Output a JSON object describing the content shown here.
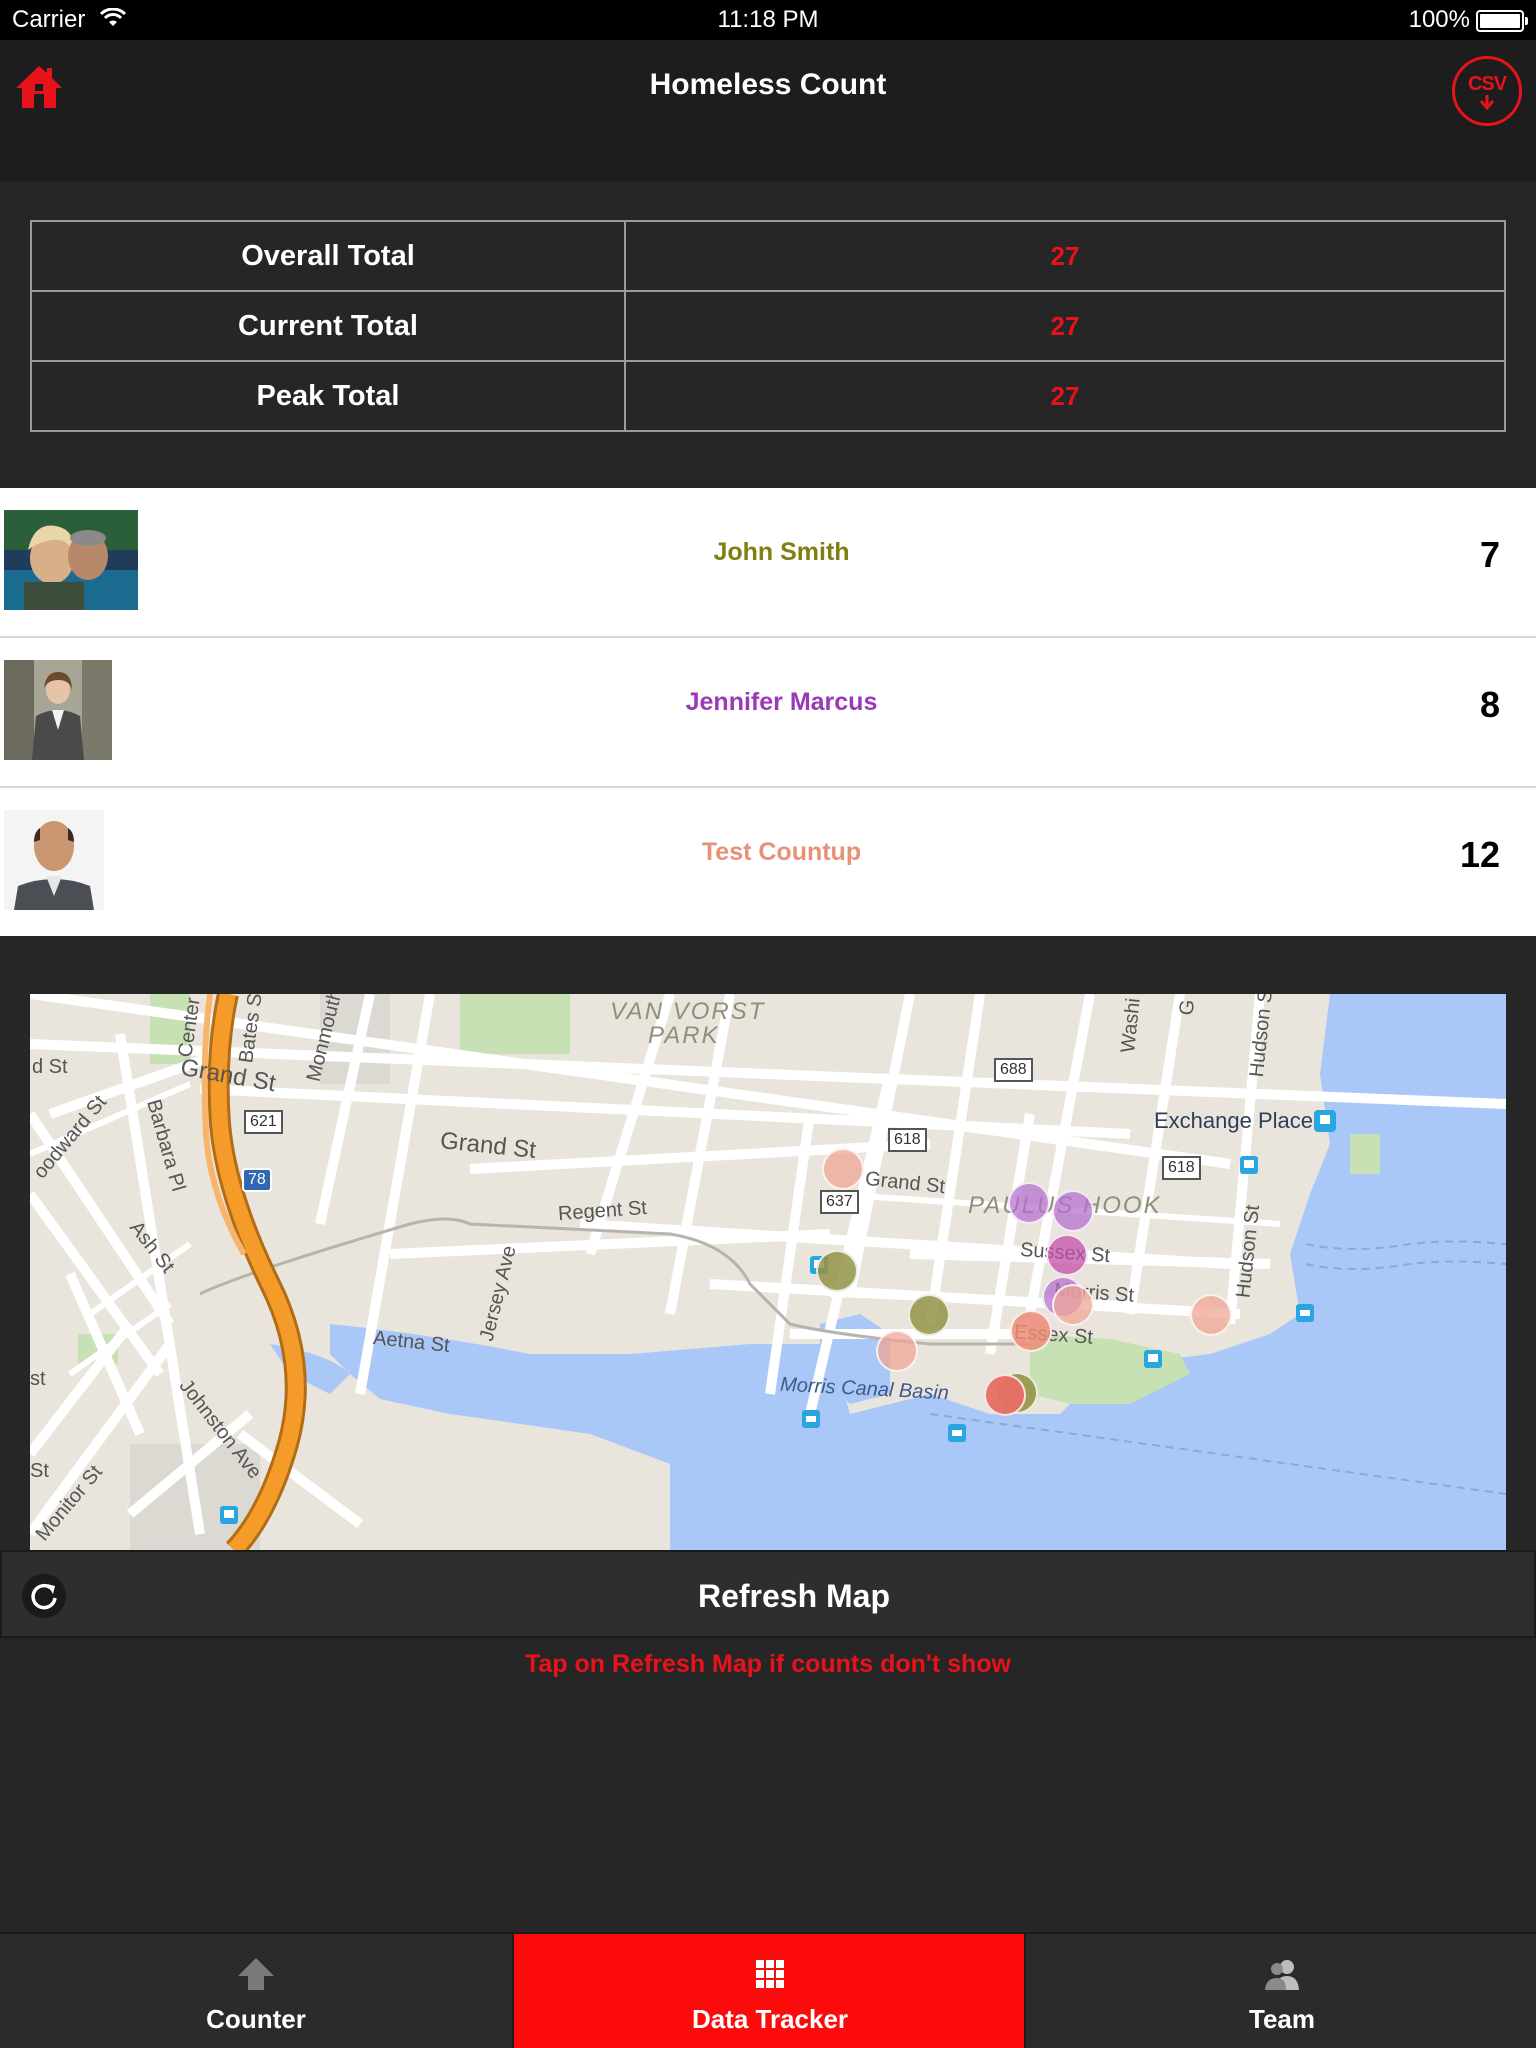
{
  "status_bar": {
    "carrier": "Carrier",
    "time": "11:18 PM",
    "battery": "100%"
  },
  "header": {
    "title": "Homeless Count",
    "home_icon": "home-icon",
    "csv_label": "CSV",
    "accent_color": "#e8121a"
  },
  "totals": [
    {
      "label": "Overall Total",
      "value": "27"
    },
    {
      "label": "Current Total",
      "value": "27"
    },
    {
      "label": "Peak Total",
      "value": "27"
    }
  ],
  "team": [
    {
      "name": "John Smith",
      "count": "7",
      "color": "#7f7f12"
    },
    {
      "name": "Jennifer Marcus",
      "count": "8",
      "color": "#9b39b8"
    },
    {
      "name": "Test Countup",
      "count": "12",
      "color": "#e59277"
    }
  ],
  "map": {
    "labels": {
      "grand_st_1": "Grand St",
      "grand_st_2": "Grand St",
      "grand_st_3": "Grand St",
      "regent_st": "Regent St",
      "aetna_st": "Aetna St",
      "jersey_ave": "Jersey Ave",
      "ash_st": "Ash St",
      "barbara_pl": "Barbara Pl",
      "johnston_ave": "Johnston Ave",
      "monitor_st": "Monitor St",
      "woodward_st": "oodward St",
      "bates_st": "Bates St",
      "center_st": "Center",
      "monmouth": "Monmouth",
      "van_vorst": "VAN VORST",
      "park": "PARK",
      "paulus_hook": "PAULUS HOOK",
      "sussex_st": "Sussex St",
      "morris_st": "Morris St",
      "essex_st": "Essex St",
      "hudson_st": "Hudson St",
      "hudson_st_top": "Hudson S",
      "washington": "Washi",
      "exchange_place": "Exchange Place",
      "morris_canal_basin": "Morris Canal Basin",
      "d_st": "d St",
      "st_left": "st",
      "st_left2": "St",
      "g_label": "G"
    },
    "shields": [
      "688",
      "618",
      "621",
      "637",
      "618",
      "78"
    ]
  },
  "refresh": {
    "label": "Refresh Map",
    "hint": "Tap on Refresh Map if counts don't show"
  },
  "tabs": [
    {
      "label": "Counter",
      "icon": "arrow-up-icon",
      "active": false
    },
    {
      "label": "Data Tracker",
      "icon": "grid-icon",
      "active": true
    },
    {
      "label": "Team",
      "icon": "team-icon",
      "active": false
    }
  ]
}
